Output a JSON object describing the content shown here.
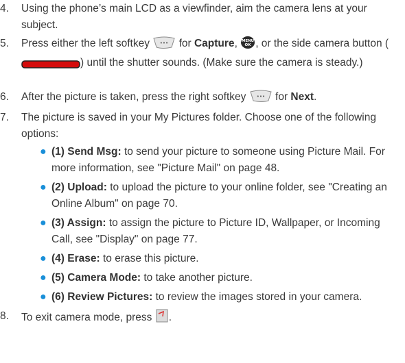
{
  "steps": [
    {
      "num": "4.",
      "text": "Using the phone’s main LCD as a viewfinder, aim the camera lens at your subject."
    },
    {
      "num": "5.",
      "a": "Press either the left softkey",
      "b": "for",
      "c": "Capture",
      "d": ",",
      "e": ", or the side camera button (",
      "f": ") until the shutter sounds. (Make sure the camera is steady.)"
    },
    {
      "num": "6.",
      "a": "After the picture is taken, press the right softkey",
      "b": "for",
      "c": "Next",
      "d": "."
    },
    {
      "num": "7.",
      "text": "The picture is saved in your My Pictures folder. Choose one of the following options:"
    },
    {
      "num": "8.",
      "a": "To exit camera mode, press",
      "b": "."
    }
  ],
  "options": [
    {
      "label": "(1) Send Msg:",
      "text": "to send your picture to someone using Picture Mail. For more information, see \"Picture Mail\" on page 48."
    },
    {
      "label": "(2) Upload:",
      "text": "to upload the picture to your online folder, see \"Creating an Online Album\" on page 70."
    },
    {
      "label": "(3) Assign:",
      "text": "to assign the picture to Picture ID, Wallpaper, or Incoming Call, see \"Display\" on page 77."
    },
    {
      "label": "(4) Erase:",
      "text": "to erase this picture."
    },
    {
      "label": "(5) Camera Mode:",
      "text": "to take another picture."
    },
    {
      "label": "(6) Review Pictures:",
      "text": "to review the images stored in your camera."
    }
  ],
  "icons": {
    "left_softkey": "left-softkey-icon",
    "menu_ok": "menu-ok-key-icon",
    "menu_ok_text_top": "MENU",
    "menu_ok_text_bottom": "OK",
    "side_camera": "side-camera-button-icon",
    "right_softkey": "right-softkey-icon",
    "end_key": "end-key-icon",
    "bullet": "bullet-dot-icon"
  },
  "colors": {
    "text": "#3a3a3a",
    "bullet": "#1a8fd8",
    "camera_button": "#e01010"
  }
}
